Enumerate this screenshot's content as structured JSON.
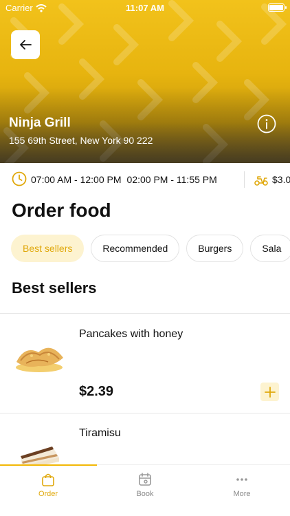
{
  "status_bar": {
    "carrier": "Carrier",
    "time": "11:07 AM"
  },
  "store": {
    "name": "Ninja Grill",
    "address": "155 69th Street, New York 90 222",
    "hours": [
      "07:00 AM - 12:00 PM",
      "02:00 PM - 11:55 PM"
    ],
    "delivery_fee": "$3.0"
  },
  "page_title": "Order food",
  "categories": [
    {
      "label": "Best sellers",
      "active": true
    },
    {
      "label": "Recommended",
      "active": false
    },
    {
      "label": "Burgers",
      "active": false
    },
    {
      "label": "Sala",
      "active": false
    }
  ],
  "section_title": "Best sellers",
  "items": [
    {
      "name": "Pancakes with honey",
      "price": "$2.39"
    },
    {
      "name": "Tiramisu",
      "price": ""
    }
  ],
  "tabs": [
    {
      "label": "Order",
      "icon": "bag-icon",
      "active": true
    },
    {
      "label": "Book",
      "icon": "calendar-icon",
      "active": false
    },
    {
      "label": "More",
      "icon": "more-icon",
      "active": false
    }
  ],
  "colors": {
    "accent": "#f2b705",
    "chip_active_bg": "#fdf3d0"
  }
}
